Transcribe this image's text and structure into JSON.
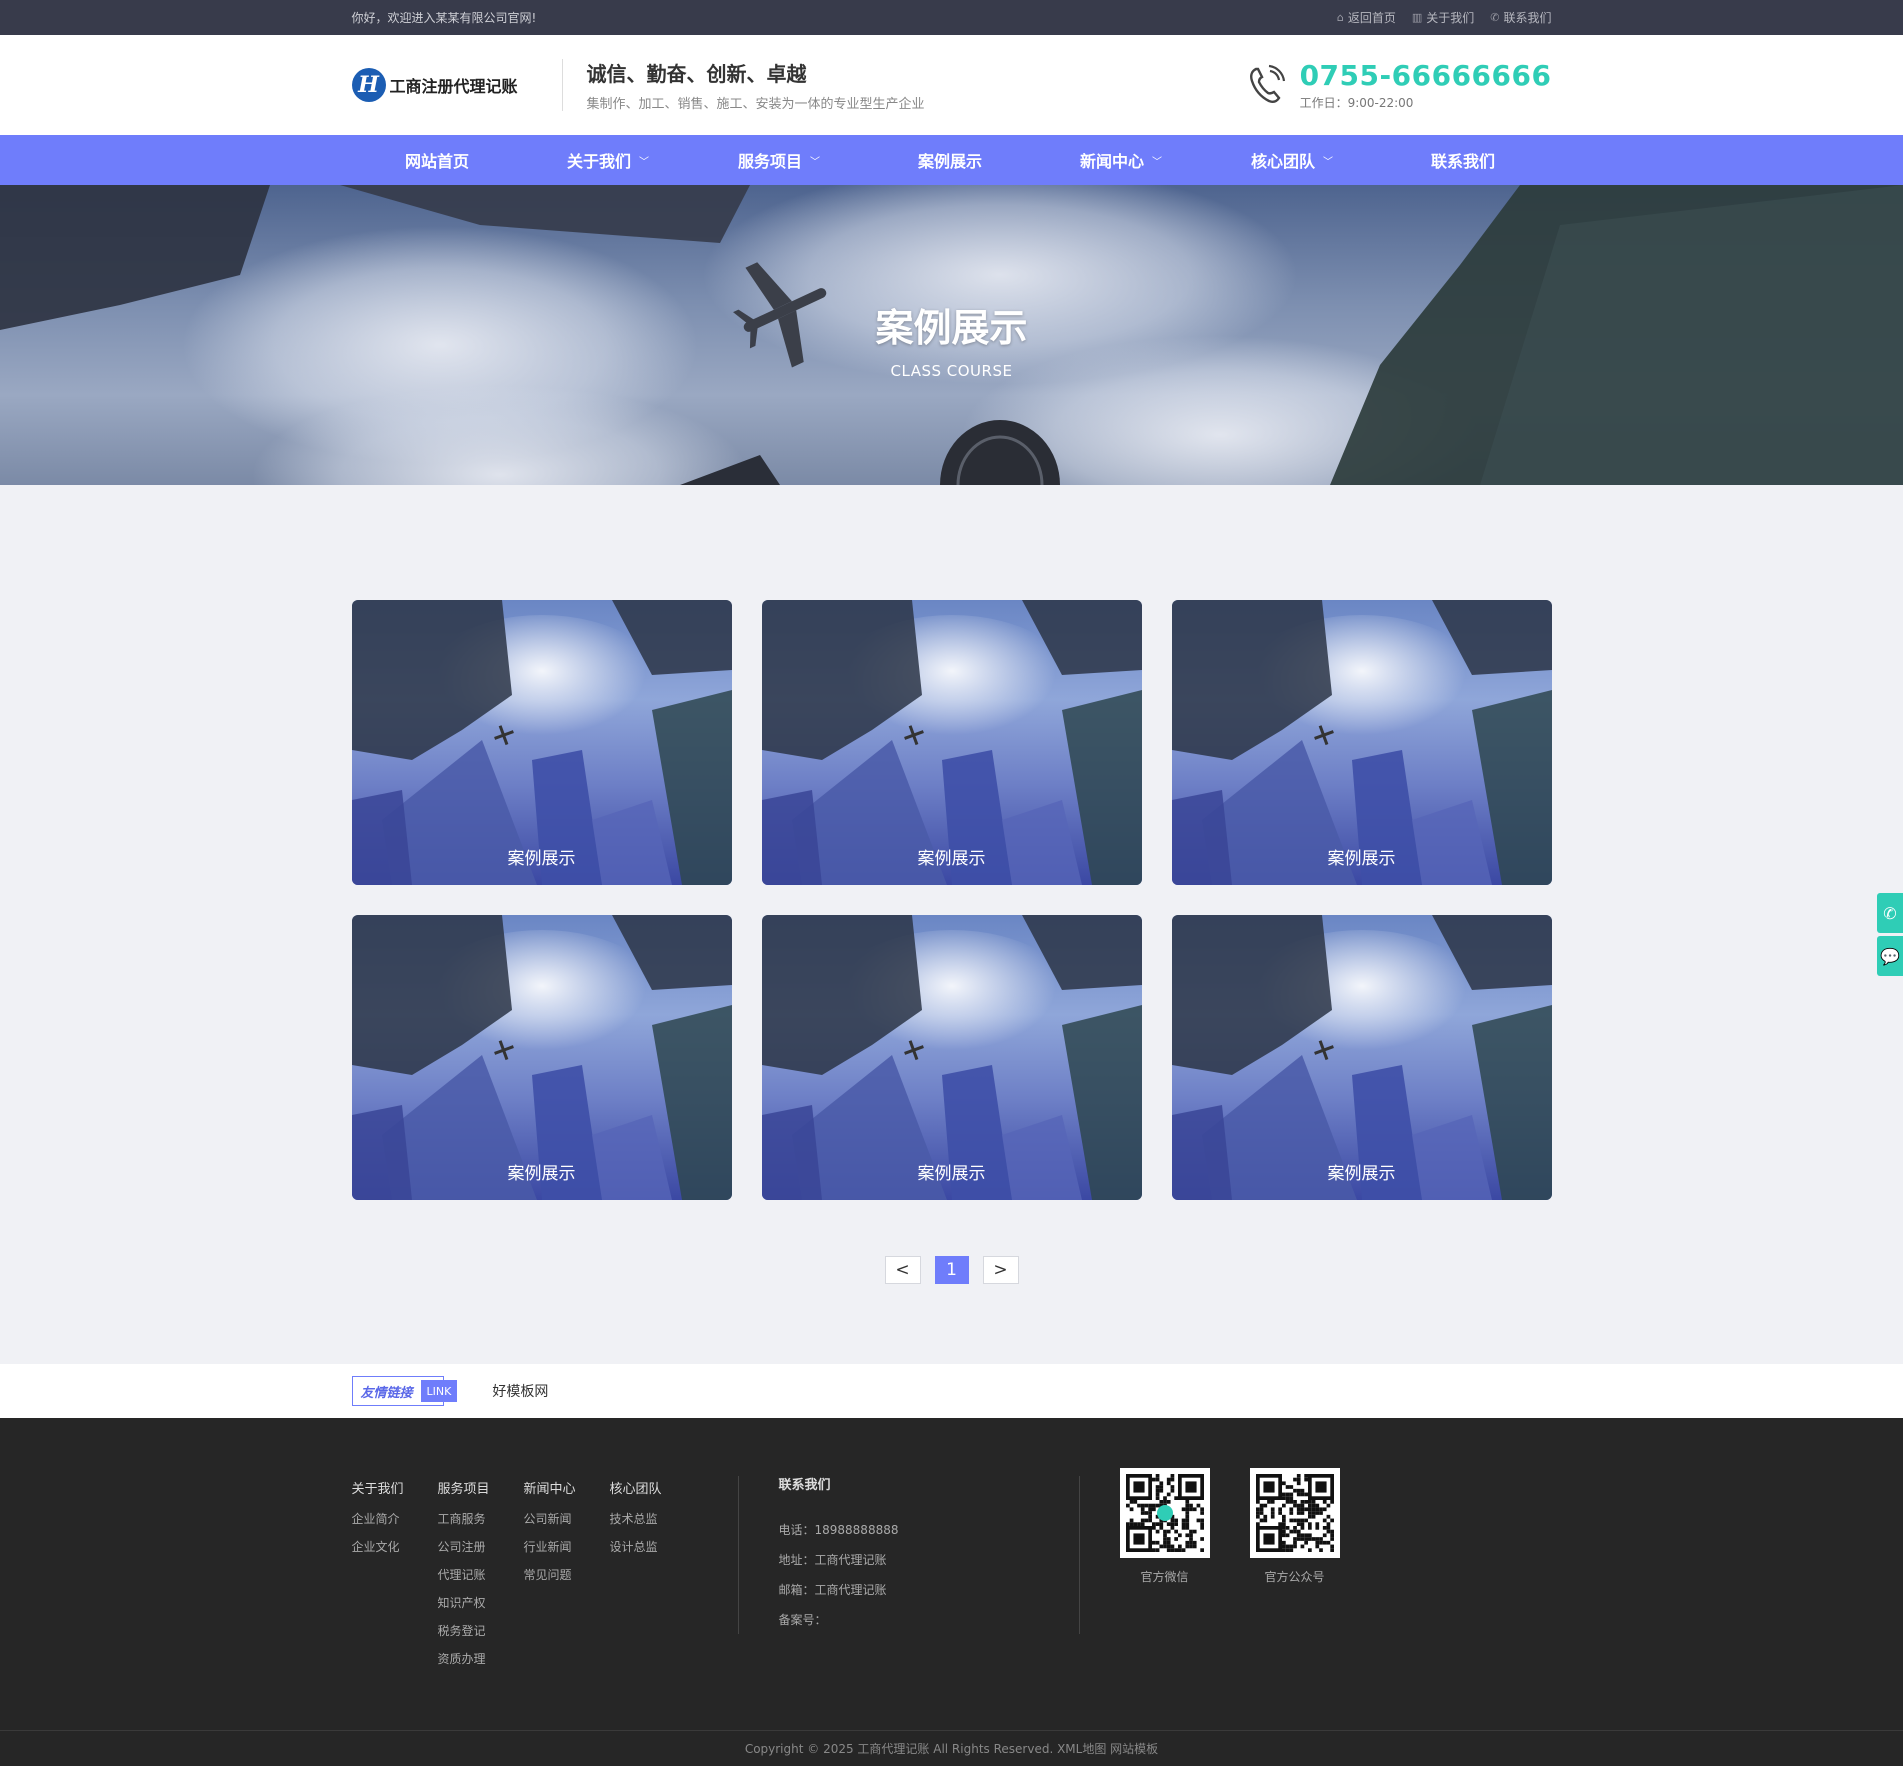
{
  "topbar": {
    "welcome": "你好，欢迎进入某某有限公司官网!",
    "links": [
      {
        "label": "返回首页",
        "icon": "home-icon"
      },
      {
        "label": "关于我们",
        "icon": "building-icon"
      },
      {
        "label": "联系我们",
        "icon": "phone-icon"
      }
    ]
  },
  "header": {
    "logo_letter": "H",
    "logo_text": "工商注册代理记账",
    "slogan_title": "诚信、勤奋、创新、卓越",
    "slogan_sub": "集制作、加工、销售、施工、安装为一体的专业型生产企业",
    "phone": "0755-66666666",
    "hours": "工作日：9:00-22:00"
  },
  "nav": {
    "items": [
      {
        "label": "网站首页"
      },
      {
        "label": "关于我们"
      },
      {
        "label": "服务项目"
      },
      {
        "label": "案例展示"
      },
      {
        "label": "新闻中心"
      },
      {
        "label": "核心团队"
      },
      {
        "label": "联系我们"
      }
    ]
  },
  "banner": {
    "title": "案例展示",
    "subtitle": "CLASS COURSE"
  },
  "cases": [
    "案例展示",
    "案例展示",
    "案例展示",
    "案例展示",
    "案例展示",
    "案例展示"
  ],
  "pager": {
    "prev": "<",
    "current": "1",
    "next": ">"
  },
  "links": {
    "tag_zh": "友情链接",
    "tag_en": "LINK",
    "items": [
      "好模板网"
    ]
  },
  "footer": {
    "menu": [
      {
        "title": "关于我们",
        "items": [
          "企业简介",
          "企业文化"
        ]
      },
      {
        "title": "服务项目",
        "items": [
          "工商服务",
          "公司注册",
          "代理记账",
          "知识产权",
          "税务登记",
          "资质办理"
        ]
      },
      {
        "title": "新闻中心",
        "items": [
          "公司新闻",
          "行业新闻",
          "常见问题"
        ]
      },
      {
        "title": "核心团队",
        "items": [
          "技术总监",
          "设计总监"
        ]
      }
    ],
    "contact_title": "联系我们",
    "contact": [
      "电话：18988888888",
      "地址：工商代理记账",
      "邮箱：工商代理记账",
      "备案号："
    ],
    "qr": [
      "官方微信",
      "官方公众号"
    ],
    "copyright": "Copyright © 2025 工商代理记账 All Rights Reserved. XML地图 网站模板"
  },
  "colors": {
    "accent": "#6f7dfb",
    "phone": "#2fcdb6",
    "topbar": "#383b4b",
    "footer": "#262626"
  }
}
